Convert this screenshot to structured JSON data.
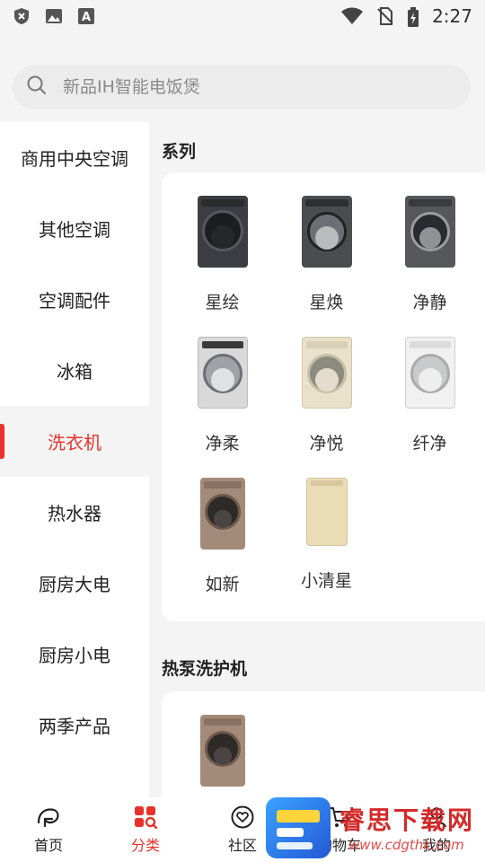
{
  "status_bar": {
    "time": "2:27",
    "left_icons": [
      "shield-x-icon",
      "image-icon",
      "text-a-icon"
    ],
    "right_icons": [
      "wifi-icon",
      "no-sim-icon",
      "battery-charging-icon"
    ]
  },
  "search": {
    "placeholder": "新品IH智能电饭煲"
  },
  "sidebar": {
    "items": [
      {
        "label": "商用中央空调"
      },
      {
        "label": "其他空调"
      },
      {
        "label": "空调配件"
      },
      {
        "label": "冰箱"
      },
      {
        "label": "洗衣机"
      },
      {
        "label": "热水器"
      },
      {
        "label": "厨房大电"
      },
      {
        "label": "厨房小电"
      },
      {
        "label": "两季产品"
      }
    ],
    "active_index": 4
  },
  "sections": [
    {
      "title": "系列",
      "products": [
        {
          "name": "星绘"
        },
        {
          "name": "星焕"
        },
        {
          "name": "净静"
        },
        {
          "name": "净柔"
        },
        {
          "name": "净悦"
        },
        {
          "name": "纤净"
        },
        {
          "name": "如新"
        },
        {
          "name": "小清星"
        }
      ]
    },
    {
      "title": "热泵洗护机",
      "products": []
    }
  ],
  "bottom_nav": {
    "items": [
      {
        "label": "首页",
        "icon": "home-icon"
      },
      {
        "label": "分类",
        "icon": "category-grid-icon"
      },
      {
        "label": "社区",
        "icon": "community-heart-icon"
      },
      {
        "label": "购物车",
        "icon": "cart-icon"
      },
      {
        "label": "我的",
        "icon": "profile-icon"
      }
    ],
    "active_index": 1
  },
  "watermark": {
    "title": "睿思下载网",
    "url": "www.cdgthk.com"
  },
  "colors": {
    "accent": "#e8322b",
    "background": "#f4f4f4"
  }
}
